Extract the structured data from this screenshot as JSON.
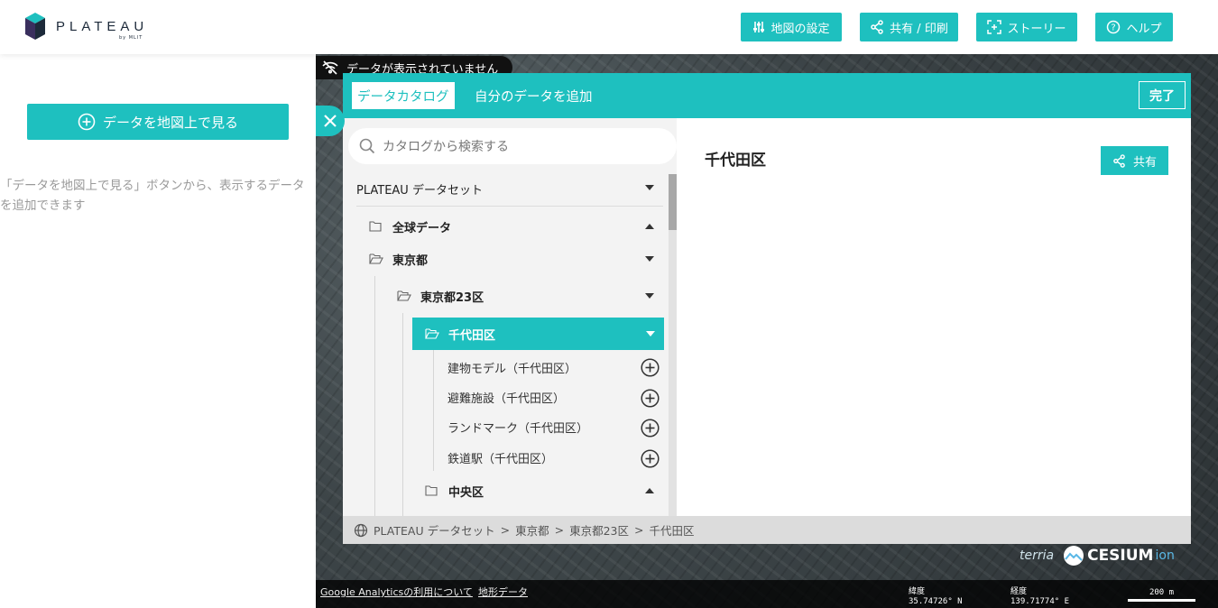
{
  "brand": {
    "name": "PLATEAU",
    "sub": "by MLIT"
  },
  "toolbar": {
    "map_settings": "地図の設定",
    "share_print": "共有 / 印刷",
    "story": "ストーリー",
    "help": "ヘルプ"
  },
  "left": {
    "add_data_button": "データを地図上で見る",
    "hint": "「データを地図上で見る」ボタンから、表示するデータを追加できます"
  },
  "map": {
    "no_data_badge": "データが表示されていません"
  },
  "modal": {
    "tab_catalog": "データカタログ",
    "tab_my_data": "自分のデータを追加",
    "done": "完了",
    "search_placeholder": "カタログから検索する",
    "tree": {
      "root": "PLATEAU データセット",
      "global": "全球データ",
      "tokyo": "東京都",
      "tokyo23": "東京都23区",
      "chiyoda": "千代田区",
      "items": [
        {
          "label": "建物モデル（千代田区）"
        },
        {
          "label": "避難施設（千代田区）"
        },
        {
          "label": "ランドマーク（千代田区）"
        },
        {
          "label": "鉄道駅（千代田区）"
        }
      ],
      "chuo": "中央区"
    },
    "detail_title": "千代田区",
    "share_button": "共有",
    "breadcrumb": [
      "PLATEAU データセット",
      "東京都",
      "東京都23区",
      "千代田区"
    ],
    "breadcrumb_sep": ">"
  },
  "status": {
    "analytics_link": "Google Analyticsの利用について",
    "terrain_link": "地形データ",
    "lat_label": "緯度",
    "lat_value": "35.74726° N",
    "lon_label": "経度",
    "lon_value": "139.71774° E",
    "scale_label": "200 m"
  },
  "credits": {
    "terria": "terria",
    "cesium": "CESIUM",
    "ion": "ion"
  },
  "colors": {
    "accent": "#1ec0bf",
    "status_bg": "#111111"
  },
  "icons": [
    "logo-cube-icon",
    "sliders-icon",
    "share-icon",
    "story-icon",
    "help-icon",
    "plus-circle-icon",
    "no-data-icon",
    "close-icon",
    "search-icon",
    "folder-icon",
    "folder-open-icon",
    "caret-down-icon",
    "caret-up-icon",
    "globe-icon"
  ]
}
